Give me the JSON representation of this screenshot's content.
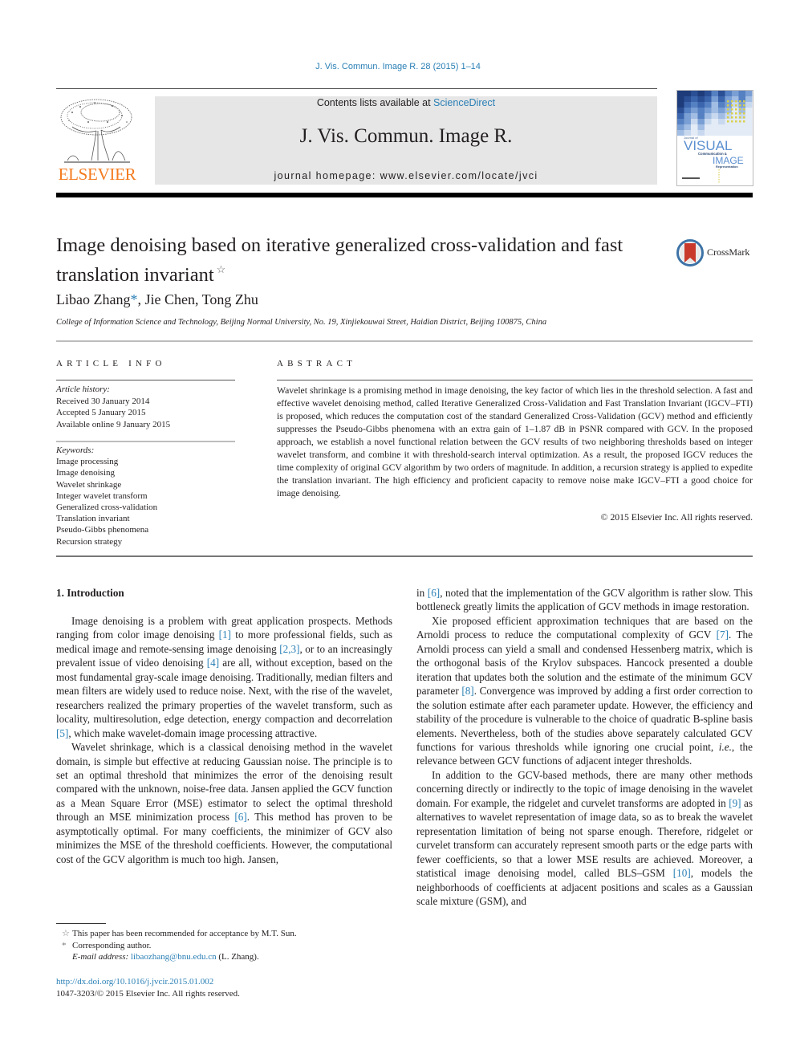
{
  "header": {
    "journal_reference": "J. Vis. Commun. Image R. 28 (2015) 1–14",
    "contents_prefix": "Contents lists available at ",
    "contents_link": "ScienceDirect",
    "journal_title": "J. Vis. Commun. Image R.",
    "homepage_line": "journal homepage: www.elsevier.com/locate/jvci",
    "publisher_logo_text": "ELSEVIER",
    "cover": {
      "line1": "Journal of",
      "line2": "VISUAL",
      "line3": "Communication &",
      "line4": "IMAGE",
      "line5": "Representation"
    }
  },
  "article": {
    "title": "Image denoising based on iterative generalized cross-validation and fast translation invariant",
    "title_mark": "☆",
    "crossmark_label": "CrossMark",
    "authors": [
      {
        "name": "Libao Zhang",
        "mark": "*"
      },
      {
        "name": "Jie Chen",
        "mark": ""
      },
      {
        "name": "Tong Zhu",
        "mark": ""
      }
    ],
    "author_separator": ", ",
    "affiliation": "College of Information Science and Technology, Beijing Normal University, No. 19, Xinjiekouwai Street, Haidian District, Beijing 100875, China"
  },
  "article_info": {
    "heading": "ARTICLE INFO",
    "history_label": "Article history:",
    "history": [
      "Received 30 January 2014",
      "Accepted 5 January 2015",
      "Available online 9 January 2015"
    ],
    "keywords_label": "Keywords:",
    "keywords": [
      "Image processing",
      "Image denoising",
      "Wavelet shrinkage",
      "Integer wavelet transform",
      "Generalized cross-validation",
      "Translation invariant",
      "Pseudo-Gibbs phenomena",
      "Recursion strategy"
    ]
  },
  "abstract": {
    "heading": "ABSTRACT",
    "text": "Wavelet shrinkage is a promising method in image denoising, the key factor of which lies in the threshold selection. A fast and effective wavelet denoising method, called Iterative Generalized Cross-Validation and Fast Translation Invariant (IGCV–FTI) is proposed, which reduces the computation cost of the stan­da­rd Generalized Cross-Validation (GCV) method and efficiently suppresses the Pseudo-Gibbs phenom­ena with an extra gain of 1–1.87 dB in PSNR compared with GCV. In the proposed approach, we establish a novel functional relation between the GCV results of two neighboring thresholds based on integer wavelet transform, and combine it with threshold-search interval optimization. As a result, the proposed IGCV reduces the time complexity of original GCV algorithm by two orders of magnitude. In addition, a recursion strategy is applied to expedite the translation invariant. The high efficiency and pro­ficient capacity to remove noise make IGCV–FTI a good choice for image denoising.",
    "copyright": "© 2015 Elsevier Inc. All rights reserved."
  },
  "body": {
    "section_heading": "1. Introduction",
    "left_paragraphs": [
      {
        "indent": true,
        "parts": [
          {
            "t": "Image denoising is a problem with great application prospects. Methods ranging from color image denoising "
          },
          {
            "ref": "[1]"
          },
          {
            "t": " to more profes­sional fields, such as medical image and remote-sensing image denoising "
          },
          {
            "ref": "[2,3]"
          },
          {
            "t": ", or to an increasingly prevalent issue of video deno­ising "
          },
          {
            "ref": "[4]"
          },
          {
            "t": " are all, without exception, based on the most fundamental gray-scale image denoising. Traditionally, median filters and mean filters are widely used to reduce noise. Next, with the rise of the wavelet, researchers realized the primary properties of the wavelet transform, such as locality, multiresolution, edge detection, energy compaction and decorrelation "
          },
          {
            "ref": "[5]"
          },
          {
            "t": ", which make wavelet-domain image processing attractive."
          }
        ]
      },
      {
        "indent": true,
        "parts": [
          {
            "t": "Wavelet shrinkage, which is a classical denoising method in the wavelet domain, is simple but effective at reducing Gaussian noise. The principle is to set an optimal threshold that minimizes the error of the denoising result compared with the unknown, noise-free data. Jansen applied the GCV function as a Mean Square Error (MSE) estimator to select the optimal threshold through an MSE minimization process "
          },
          {
            "ref": "[6]"
          },
          {
            "t": ". This method has proven to be asymptot­ically optimal. For many coefficients, the minimizer of GCV also minimizes the MSE of the threshold coefficients. However, the computational cost of the GCV algorithm is much too high. Jansen,"
          }
        ]
      }
    ],
    "right_paragraphs": [
      {
        "indent": false,
        "parts": [
          {
            "t": "in "
          },
          {
            "ref": "[6]"
          },
          {
            "t": ", noted that the implementation of the GCV algorithm is rather slow. This bottleneck greatly limits the application of GCV methods in image restoration."
          }
        ]
      },
      {
        "indent": true,
        "parts": [
          {
            "t": "Xie proposed efficient approximation techniques that are based on the Arnoldi process to reduce the computational complexity of GCV "
          },
          {
            "ref": "[7]"
          },
          {
            "t": ". The Arnoldi process can yield a small and condensed Hes­senberg matrix, which is the orthogonal basis of the Krylov sub­spaces. Hancock presented a double iteration that updates both the solution and the estimate of the minimum GCV parameter "
          },
          {
            "ref": "[8]"
          },
          {
            "t": ". Convergence was improved by adding a first order correction to the solution estimate after each parameter update. However, the efficiency and stability of the procedure is vulnerable to the choice of quadratic B-spline basis elements. Nevertheless, both of the studies above separately calculated GCV functions for various thresholds while ignoring one crucial point, "
          },
          {
            "i": "i.e."
          },
          {
            "t": ", the relevance between GCV functions of adjacent integer thresholds."
          }
        ]
      },
      {
        "indent": true,
        "parts": [
          {
            "t": "In addition to the GCV-based methods, there are many other methods concerning directly or indirectly to the topic of image denoising in the wavelet domain. For example, the ridgelet and curvelet transforms are adopted in "
          },
          {
            "ref": "[9]"
          },
          {
            "t": " as alternatives to wavelet representation of image data, so as to break the wavelet represen­tation limitation of being not sparse enough. Therefore, ridgelet or curvelet transform can accurately represent smooth parts or the edge parts with fewer coefficients, so that a lower MSE results are achieved. Moreover, a statistical image denoising model, called BLS–GSM "
          },
          {
            "ref": "[10]"
          },
          {
            "t": ", models the neighborhoods of coefficients at adja­cent positions and scales as a Gaussian scale mixture (GSM), and"
          }
        ]
      }
    ]
  },
  "footnotes": {
    "star_mark": "☆",
    "star_note": "This paper has been recommended for acceptance by M.T. Sun.",
    "corr_mark": "*",
    "corr_note": "Corresponding author.",
    "email_label": "E-mail address:",
    "email": "libaozhang@bnu.edu.cn",
    "email_suffix": " (L. Zhang).",
    "doi": "http://dx.doi.org/10.1016/j.jvcir.2015.01.002",
    "issn_line": "1047-3203/© 2015 Elsevier Inc. All rights reserved."
  },
  "colors": {
    "link": "#2a7fb5",
    "elsevier_orange": "#f47b20",
    "banner_gray": "#e6e6e6"
  }
}
